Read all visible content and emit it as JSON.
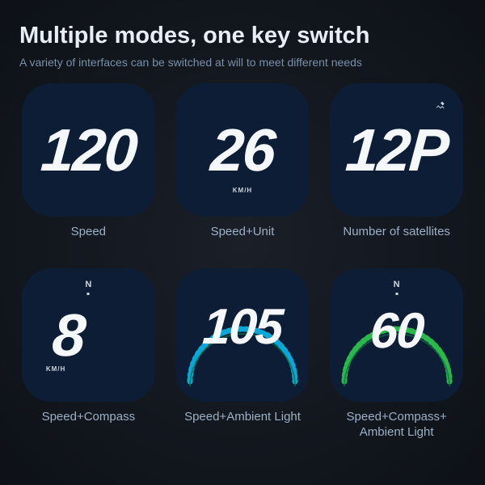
{
  "title": "Multiple modes, one key switch",
  "subtitle": "A variety of interfaces can be switched at will to meet different needs",
  "modes": [
    {
      "value": "120",
      "caption": "Speed"
    },
    {
      "value": "26",
      "caption": "Speed+Unit",
      "unit": "KM/H"
    },
    {
      "value": "12P",
      "caption": "Number of satellites"
    },
    {
      "value": "8",
      "caption": "Speed+Compass",
      "unit": "KM/H",
      "compass": "N"
    },
    {
      "value": "105",
      "caption": "Speed+Ambient Light"
    },
    {
      "value": "60",
      "caption": "Speed+Compass+ Ambient Light",
      "compass": "N"
    }
  ]
}
